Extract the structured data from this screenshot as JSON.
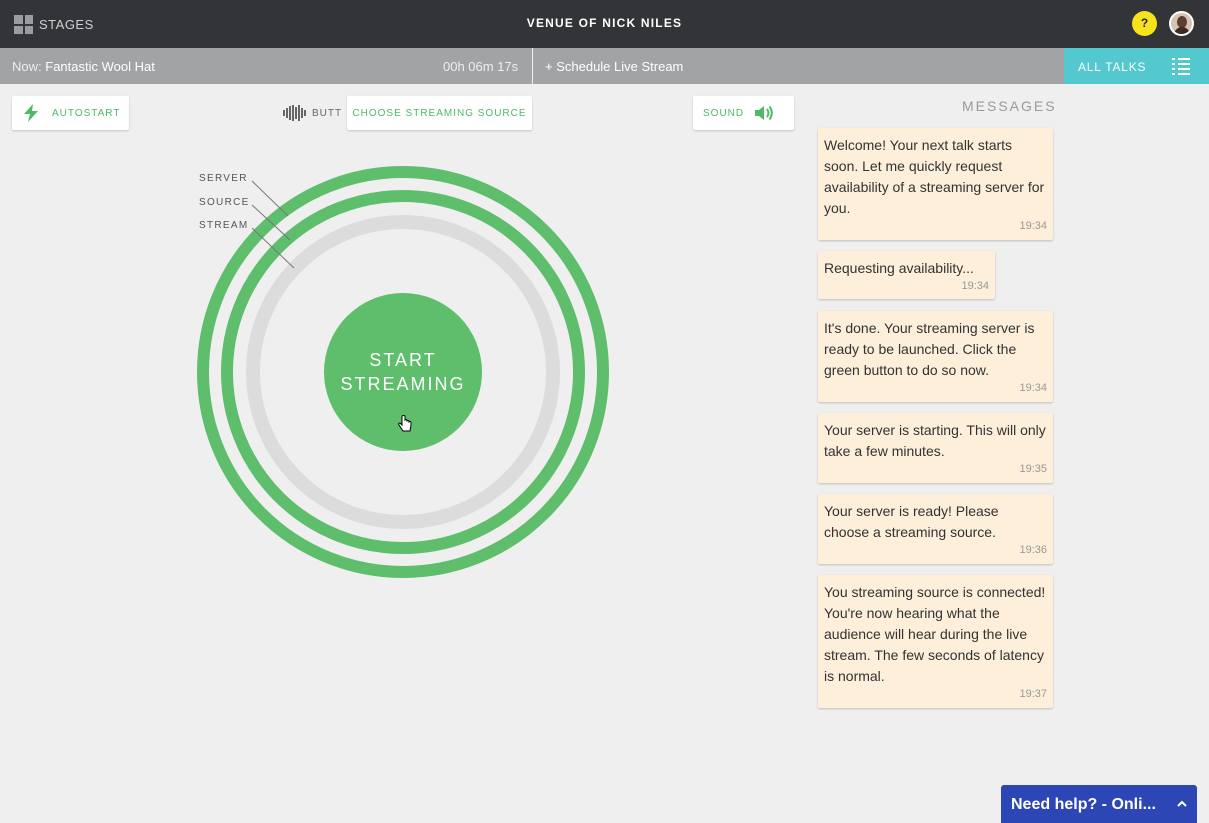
{
  "topbar": {
    "stages_label": "STAGES",
    "venue_title": "VENUE OF NICK NILES",
    "help_label": "?"
  },
  "nowbar": {
    "now_prefix": "Now:",
    "now_title": "Fantastic Wool Hat",
    "elapsed": "00h 06m 17s",
    "schedule_label": "+ Schedule Live Stream",
    "all_talks_label": "ALL TALKS"
  },
  "controls": {
    "autostart_label": "AUTOSTART",
    "source_name": "BUTT",
    "choose_source_label": "CHOOSE STREAMING SOURCE",
    "sound_label": "SOUND"
  },
  "status_rings": {
    "labels": [
      "SERVER",
      "SOURCE",
      "STREAM"
    ],
    "colors": {
      "active": "#5ebe6c",
      "inactive": "#dcdcdc"
    },
    "start_button_label": "START STREAMING"
  },
  "messages": {
    "header": "MESSAGES",
    "items": [
      {
        "text": "Welcome! Your next talk starts soon. Let me quickly request availability of a streaming server for you.",
        "time": "19:34"
      },
      {
        "text": "Requesting availability...",
        "time": "19:34"
      },
      {
        "text": "It's done. Your streaming server is ready to be launched. Click the green button to do so now.",
        "time": "19:34"
      },
      {
        "text": "Your server is starting. This will only take a few minutes.",
        "time": "19:35"
      },
      {
        "text": "Your server is ready! Please choose a streaming source.",
        "time": "19:36"
      },
      {
        "text": "You streaming source is connected! You're now hearing what the audience will hear during the live stream. The few seconds of latency is normal.",
        "time": "19:37"
      }
    ]
  },
  "help_widget": {
    "label": "Need help? - Onli..."
  }
}
